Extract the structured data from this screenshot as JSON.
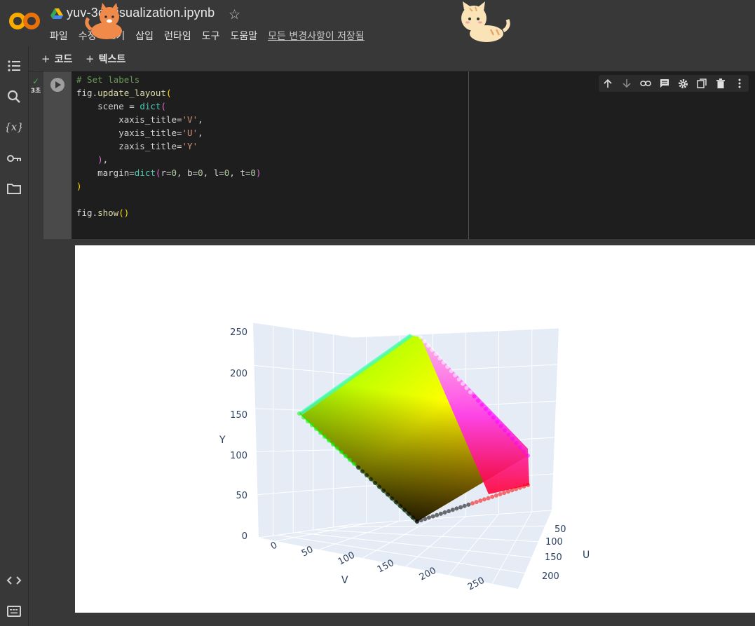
{
  "header": {
    "logo": "CO",
    "title": "yuv-3d-visualization.ipynb",
    "star_icon": "star-icon",
    "menu": [
      "파일",
      "수정",
      "보기",
      "삽입",
      "런타임",
      "도구",
      "도움말"
    ],
    "saved_status": "모든 변경사항이 저장됨"
  },
  "toolbar": {
    "add_code": "코드",
    "add_text": "텍스트"
  },
  "sidebar": {
    "icons": [
      "table-of-contents-icon",
      "search-icon",
      "variables-icon",
      "secrets-key-icon",
      "files-folder-icon"
    ],
    "bottom_icons": [
      "code-snippets-icon",
      "terminal-icon"
    ]
  },
  "cell": {
    "exec_time": "3초",
    "code_lines": [
      "# Set labels",
      "fig.update_layout(",
      "    scene = dict(",
      "        xaxis_title='V',",
      "        yaxis_title='U',",
      "        zaxis_title='Y'",
      "    ),",
      "    margin=dict(r=0, b=0, l=0, t=0)",
      ")",
      "",
      "fig.show()"
    ],
    "toolbar_icons": [
      "move-up-icon",
      "move-down-icon",
      "link-icon",
      "comment-icon",
      "settings-gear-icon",
      "mirror-cell-icon",
      "delete-trash-icon",
      "more-options-icon"
    ]
  },
  "chart_data": {
    "type": "scatter",
    "title": "",
    "xlabel": "V",
    "ylabel": "U",
    "zlabel": "Y",
    "x_ticks": [
      "0",
      "50",
      "100",
      "150",
      "200",
      "250"
    ],
    "y_ticks": [
      "50",
      "100",
      "150",
      "200"
    ],
    "z_ticks": [
      "0",
      "50",
      "100",
      "150",
      "200",
      "250"
    ],
    "xlim": [
      0,
      255
    ],
    "ylim": [
      0,
      255
    ],
    "zlim": [
      0,
      255
    ],
    "grid": true,
    "colors": {
      "corner_black": "#000000",
      "corner_green": "#00ff00",
      "corner_red": "#ff0000",
      "corner_yellow": "#ffff00",
      "corner_magenta": "#ff00ff",
      "corner_white": "#ffffff",
      "corner_cyan": "#00ffff",
      "background": "#e5ecf6"
    }
  }
}
